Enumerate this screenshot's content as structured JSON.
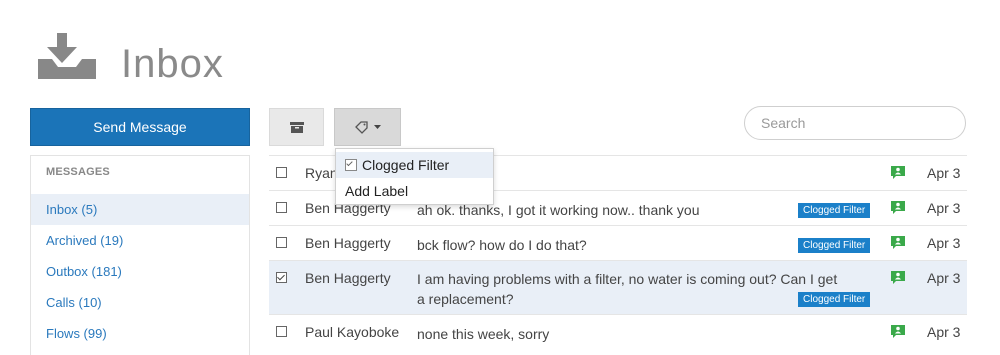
{
  "header": {
    "title": "Inbox",
    "icon": "inbox-tray-icon"
  },
  "sidebar": {
    "send_label": "Send Message",
    "section_title": "MESSAGES",
    "items": [
      {
        "label": "Inbox (5)"
      },
      {
        "label": "Archived (19)"
      },
      {
        "label": "Outbox (181)"
      },
      {
        "label": "Calls (10)"
      },
      {
        "label": "Flows (99)"
      }
    ]
  },
  "toolbar": {
    "archive_icon": "archive-box-icon",
    "label_icon": "tag-icon",
    "search_placeholder": "Search"
  },
  "dropdown": {
    "items": [
      {
        "label": "Clogged Filter",
        "checked": true
      },
      {
        "label": "Add Label"
      }
    ]
  },
  "messages": [
    {
      "sender": "Ryan",
      "text": "",
      "badge": "",
      "date": "Apr 3"
    },
    {
      "sender": "Ben Haggerty",
      "text": "ah ok. thanks, I got it working now.. thank you",
      "badge": "Clogged Filter",
      "date": "Apr 3"
    },
    {
      "sender": "Ben Haggerty",
      "text": "bck flow? how do I do that?",
      "badge": "Clogged Filter",
      "date": "Apr 3"
    },
    {
      "sender": "Ben Haggerty",
      "text": "I am having problems with a filter, no water is coming out? Can I get a replacement?",
      "badge": "Clogged Filter",
      "date": "Apr 3",
      "checked": true
    },
    {
      "sender": "Paul Kayoboke",
      "text": "none this week, sorry",
      "badge": "",
      "date": "Apr 3"
    }
  ],
  "colors": {
    "accent": "#1b74b8",
    "badge": "#1b80c9",
    "status_green": "#3aa94a",
    "selected_bg": "#e9eff7"
  }
}
